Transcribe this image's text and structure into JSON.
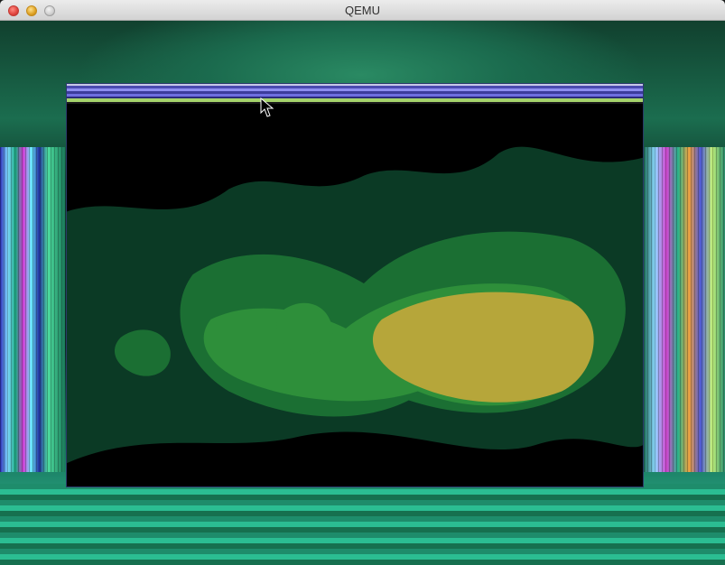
{
  "window": {
    "title": "QEMU"
  },
  "colors": {
    "close": "#e0443e",
    "minimize": "#dea123",
    "zoom": "#cfcfcf",
    "titlebar": "#ececec",
    "screen_bg": "#0d3a2a",
    "contour_dark": "#0b3a25",
    "contour_mid": "#1b6f33",
    "contour_light": "#2e8f3a",
    "contour_yellow": "#b6a63a"
  }
}
